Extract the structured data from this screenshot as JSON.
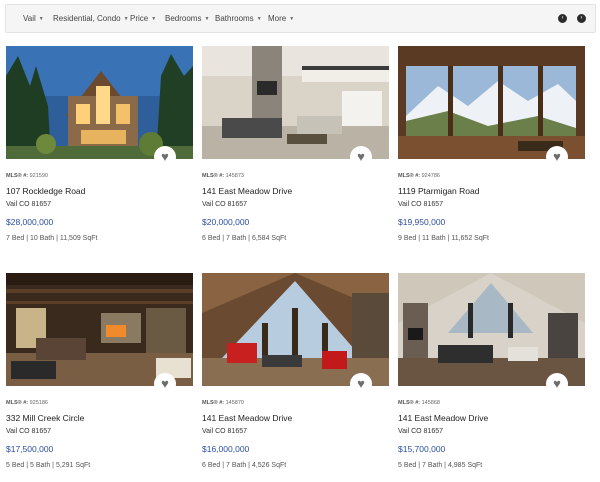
{
  "filters": {
    "items": [
      {
        "label": "Vail"
      },
      {
        "label": "Residential, Condo"
      },
      {
        "label": "Price"
      },
      {
        "label": "Bedrooms"
      },
      {
        "label": "Bathrooms"
      },
      {
        "label": "More"
      }
    ],
    "caret_icon": "caret-down-icon",
    "prev_icon": "chevron-left-icon",
    "next_icon": "chevron-right-icon"
  },
  "listings": [
    {
      "mls_label": "MLS® #:",
      "mls": "921590",
      "street": "107 Rockledge Road",
      "city": "Vail CO 81657",
      "price": "$28,000,000",
      "specs": "7 Bed | 10 Bath | 11,509 SqFt"
    },
    {
      "mls_label": "MLS® #:",
      "mls": "145873",
      "street": "141 East Meadow Drive",
      "city": "Vail CO 81657",
      "price": "$20,000,000",
      "specs": "6 Bed | 7 Bath | 6,584 SqFt"
    },
    {
      "mls_label": "MLS® #:",
      "mls": "924786",
      "street": "1119 Ptarmigan Road",
      "city": "Vail CO 81657",
      "price": "$19,950,000",
      "specs": "9 Bed | 11 Bath | 11,652 SqFt"
    },
    {
      "mls_label": "MLS® #:",
      "mls": "925186",
      "street": "332 Mill Creek Circle",
      "city": "Vail CO 81657",
      "price": "$17,500,000",
      "specs": "5 Bed | 5 Bath | 5,291 SqFt"
    },
    {
      "mls_label": "MLS® #:",
      "mls": "145870",
      "street": "141 East Meadow Drive",
      "city": "Vail CO 81657",
      "price": "$16,000,000",
      "specs": "6 Bed | 7 Bath | 4,526 SqFt"
    },
    {
      "mls_label": "MLS® #:",
      "mls": "145868",
      "street": "141 East Meadow Drive",
      "city": "Vail CO 81657",
      "price": "$15,700,000",
      "specs": "5 Bed | 7 Bath | 4,985 SqFt"
    }
  ],
  "favorite_icon": "heart-icon",
  "colors": {
    "price": "#2c4f9e",
    "filter_bar": "#f5f5f5",
    "heart": "#6e6e6e"
  }
}
